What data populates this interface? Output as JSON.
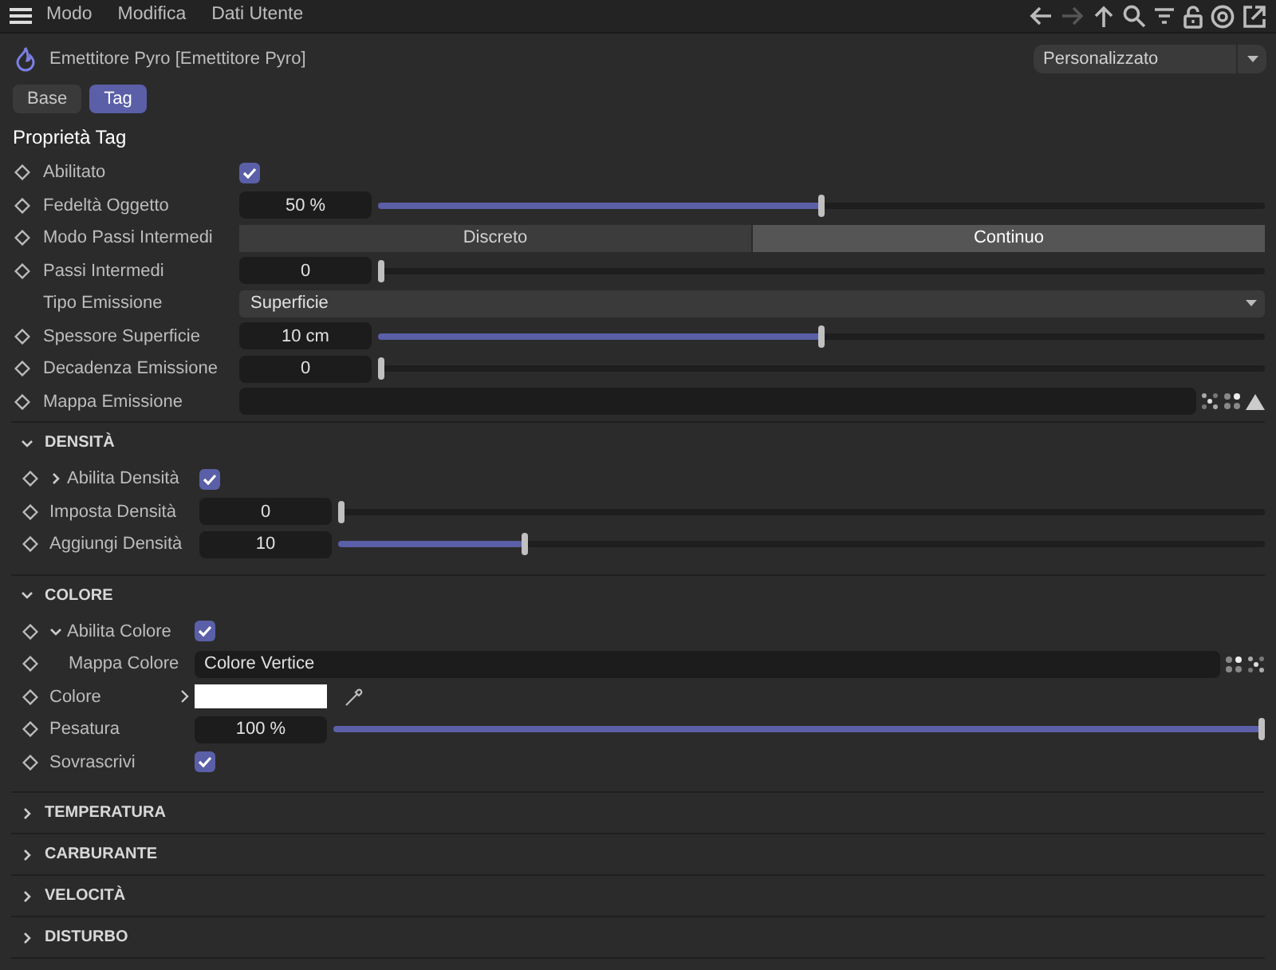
{
  "menu": [
    "Modo",
    "Modifica",
    "Dati Utente"
  ],
  "object_title": "Emettitore Pyro [Emettitore Pyro]",
  "preset": "Personalizzato",
  "tabs": [
    {
      "label": "Base",
      "selected": false
    },
    {
      "label": "Tag",
      "selected": true
    }
  ],
  "heading": "Proprietà Tag",
  "main_rows": [
    {
      "kind": "checkbox",
      "label": "Abilitato",
      "keyframe": true,
      "checked": true
    },
    {
      "kind": "slider",
      "label": "Fedeltà Oggetto",
      "keyframe": true,
      "value": "50 %",
      "level": 0.5
    },
    {
      "kind": "segmented",
      "label": "Modo Passi Intermedi",
      "keyframe": true,
      "options": [
        {
          "label": "Discreto",
          "selected": false
        },
        {
          "label": "Continuo",
          "selected": true
        }
      ]
    },
    {
      "kind": "slider",
      "label": "Passi Intermedi",
      "keyframe": true,
      "value": "0",
      "level": 0
    },
    {
      "kind": "dropdown",
      "label": "Tipo Emissione",
      "keyframe": false,
      "value": "Superficie"
    },
    {
      "kind": "slider",
      "label": "Spessore Superficie",
      "keyframe": true,
      "value": "10 cm",
      "level": 0.5
    },
    {
      "kind": "slider",
      "label": "Decadenza Emissione",
      "keyframe": true,
      "value": "0",
      "level": 0
    },
    {
      "kind": "link",
      "label": "Mappa Emissione",
      "keyframe": true
    }
  ],
  "sections": [
    {
      "title": "DENSITÀ",
      "expanded": true,
      "rows": [
        {
          "kind": "checkbox",
          "label": "Abilita Densità",
          "keyframe": true,
          "checked": true,
          "expander": {
            "expanded": false
          }
        },
        {
          "kind": "slider",
          "label": "Imposta Densità",
          "keyframe": true,
          "value": "0",
          "level": 0
        },
        {
          "kind": "slider",
          "label": "Aggiungi Densità",
          "keyframe": true,
          "value": "10",
          "level": 0.2
        }
      ]
    },
    {
      "title": "COLORE",
      "expanded": true,
      "rows": [
        {
          "kind": "checkbox",
          "label": "Abilita Colore",
          "keyframe": true,
          "checked": true,
          "expander": {
            "expanded": true
          }
        },
        {
          "kind": "link",
          "label": "Mappa Colore",
          "keyframe": true,
          "sub": true,
          "value": "Colore Vertice"
        },
        {
          "kind": "color",
          "label": "Colore",
          "keyframe": true,
          "color": "#ffffff"
        },
        {
          "kind": "slider",
          "label": "Pesatura",
          "keyframe": true,
          "value": "100 %",
          "level": 1
        },
        {
          "kind": "checkbox",
          "label": "Sovrascrivi",
          "keyframe": true,
          "checked": true
        }
      ]
    },
    {
      "title": "TEMPERATURA",
      "expanded": false
    },
    {
      "title": "CARBURANTE",
      "expanded": false
    },
    {
      "title": "VELOCITÀ",
      "expanded": false
    },
    {
      "title": "DISTURBO",
      "expanded": false
    }
  ]
}
